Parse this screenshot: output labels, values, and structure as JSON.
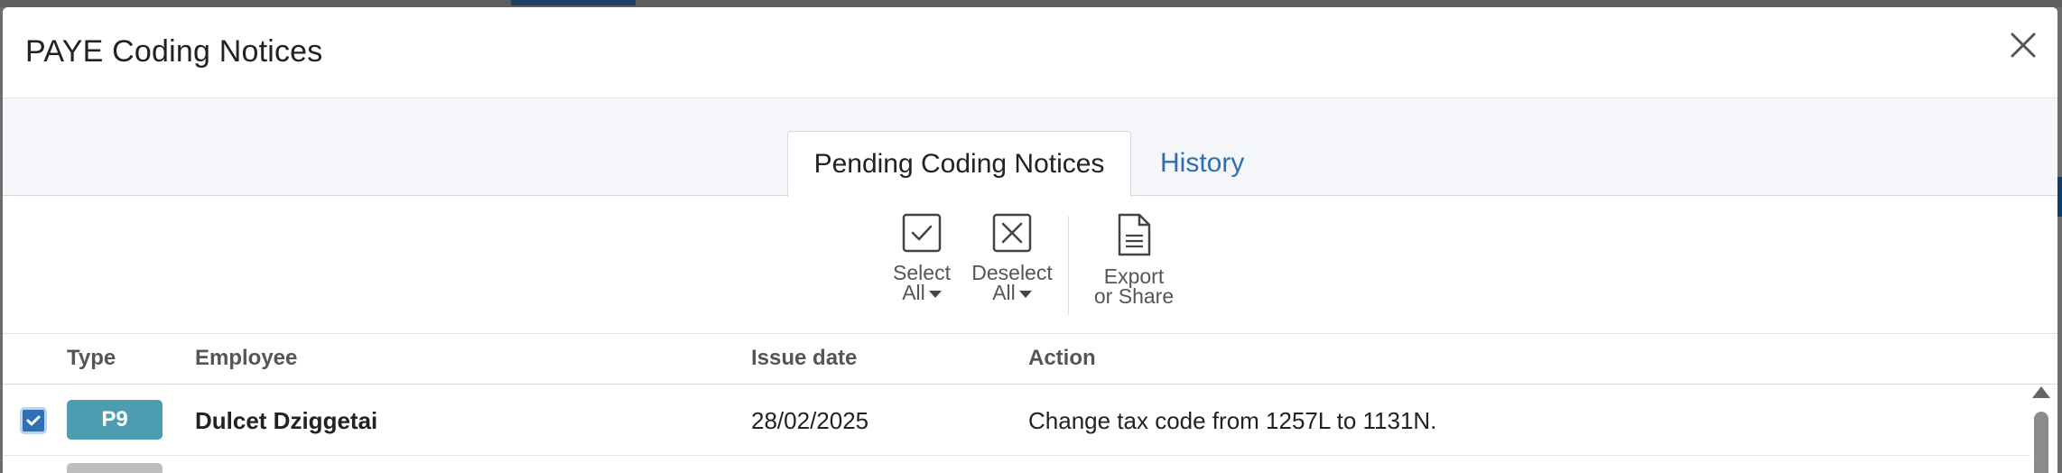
{
  "modal": {
    "title": "PAYE Coding Notices",
    "close_icon": "close-icon"
  },
  "tabs": [
    {
      "label": "Pending Coding Notices",
      "active": true
    },
    {
      "label": "History",
      "active": false
    }
  ],
  "toolbar": {
    "select_all": {
      "line1": "Select",
      "line2": "All",
      "icon": "checkbox-check-icon"
    },
    "deselect_all": {
      "line1": "Deselect",
      "line2": "All",
      "icon": "checkbox-x-icon"
    },
    "export": {
      "line1": "Export",
      "line2": "or Share",
      "icon": "document-icon"
    }
  },
  "table": {
    "columns": [
      "Type",
      "Employee",
      "Issue date",
      "Action"
    ],
    "rows": [
      {
        "selected": true,
        "type": "P9",
        "employee": "Dulcet Dziggetai",
        "issue_date": "28/02/2025",
        "action": "Change tax code from 1257L to 1131N."
      }
    ]
  },
  "colors": {
    "badge_p9": "#4b9daf",
    "link": "#2c6fb2",
    "checkbox": "#2f6fb5"
  }
}
